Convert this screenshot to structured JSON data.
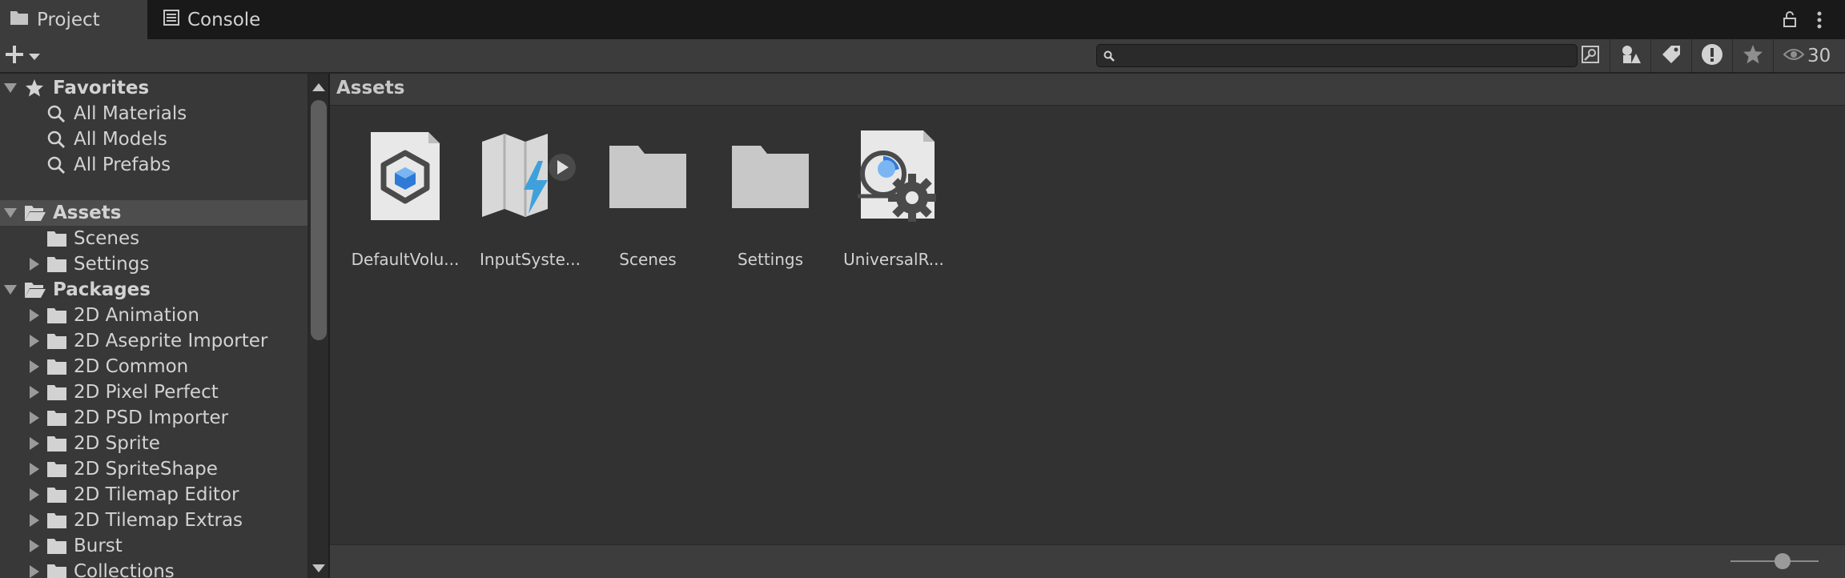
{
  "tabs": [
    {
      "label": "Project",
      "icon": "folder-icon",
      "active": true
    },
    {
      "label": "Console",
      "icon": "console-icon",
      "active": false
    }
  ],
  "toolbar": {
    "search_value": "",
    "visibility_count": "30"
  },
  "tree": {
    "favorites": {
      "label": "Favorites",
      "items": [
        "All Materials",
        "All Models",
        "All Prefabs"
      ]
    },
    "assets": {
      "label": "Assets",
      "items": [
        "Scenes",
        "Settings"
      ]
    },
    "packages": {
      "label": "Packages",
      "items": [
        "2D Animation",
        "2D Aseprite Importer",
        "2D Common",
        "2D Pixel Perfect",
        "2D PSD Importer",
        "2D Sprite",
        "2D SpriteShape",
        "2D Tilemap Editor",
        "2D Tilemap Extras",
        "Burst",
        "Collections"
      ]
    }
  },
  "main": {
    "breadcrumb": "Assets",
    "assets": [
      {
        "name": "DefaultVolu...",
        "icon": "volume-profile-icon"
      },
      {
        "name": "InputSyste...",
        "icon": "input-actions-icon"
      },
      {
        "name": "Scenes",
        "icon": "folder-icon"
      },
      {
        "name": "Settings",
        "icon": "folder-icon"
      },
      {
        "name": "UniversalR...",
        "icon": "render-pipeline-asset-icon"
      }
    ]
  }
}
